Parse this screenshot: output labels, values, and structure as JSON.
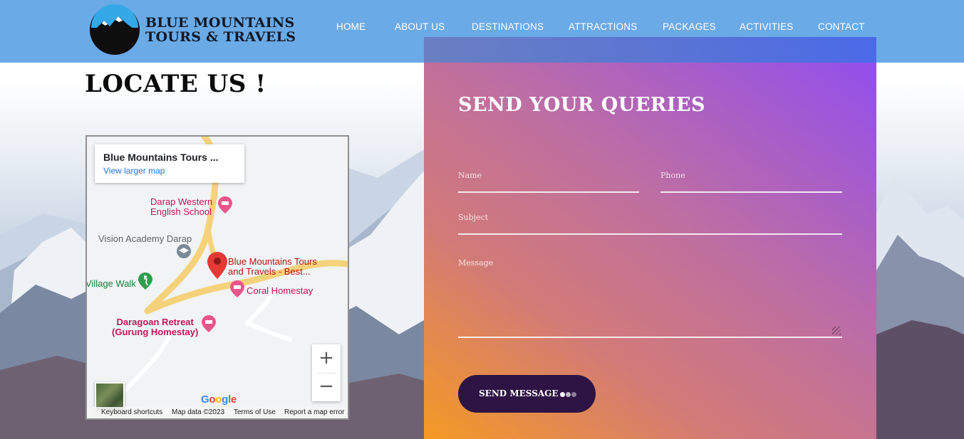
{
  "header": {
    "brand_line1": "BLUE MOUNTAINS",
    "brand_line2": "TOURS & TRAVELS",
    "nav": [
      "HOME",
      "ABOUT US",
      "DESTINATIONS",
      "ATTRACTIONS",
      "PACKAGES",
      "ACTIVITIES",
      "CONTACT"
    ]
  },
  "locate": {
    "title": "LOCATE US !"
  },
  "map": {
    "card_title": "Blue Mountains Tours ...",
    "card_link": "View larger map",
    "places": {
      "school_line1": "Darap Western",
      "school_line2": "English School",
      "academy": "Vision Academy Darap",
      "pin_line1": "Blue Mountains Tours",
      "pin_line2": "and Travels - Best...",
      "village_walk": "Village Walk",
      "homestay": "Coral Homestay",
      "retreat_line1": "Daragoan Retreat",
      "retreat_line2": "(Gurung Homestay)"
    },
    "zoom_in": "+",
    "zoom_out": "−",
    "google": "Google",
    "footer": [
      "Keyboard shortcuts",
      "Map data ©2023",
      "Terms of Use",
      "Report a map error"
    ]
  },
  "form": {
    "title": "SEND YOUR QUERIES",
    "name_placeholder": "Name",
    "phone_placeholder": "Phone",
    "subject_placeholder": "Subject",
    "message_placeholder": "Message",
    "submit_label": "SEND MESSAGE"
  },
  "colors": {
    "header_bg": "#6aaae6",
    "button_bg": "#2d1444",
    "gradient_start": "#f59a23",
    "gradient_end": "#8f4df2"
  }
}
